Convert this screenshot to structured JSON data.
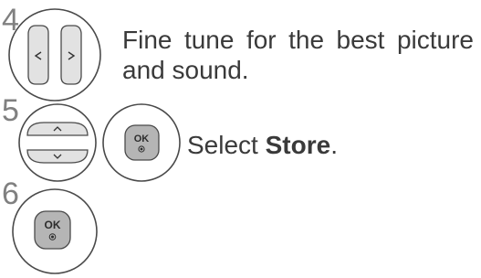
{
  "steps": [
    {
      "number": "4",
      "line1": "Fine tune for the best picture",
      "line2": "and sound.",
      "buttons": [
        "left-arrow-icon",
        "right-arrow-icon"
      ]
    },
    {
      "number": "5",
      "prefix": "Select ",
      "strong": "Store",
      "suffix": ".",
      "buttons": [
        "up-arrow-icon",
        "down-arrow-icon",
        "ok-button"
      ]
    },
    {
      "number": "6",
      "buttons": [
        "ok-button"
      ]
    }
  ],
  "ok_label": "OK",
  "colors": {
    "outline": "#4a4a4a",
    "button_fill": "#e2e2e2",
    "ok_fill": "#b5b5b5",
    "number": "#808080"
  }
}
